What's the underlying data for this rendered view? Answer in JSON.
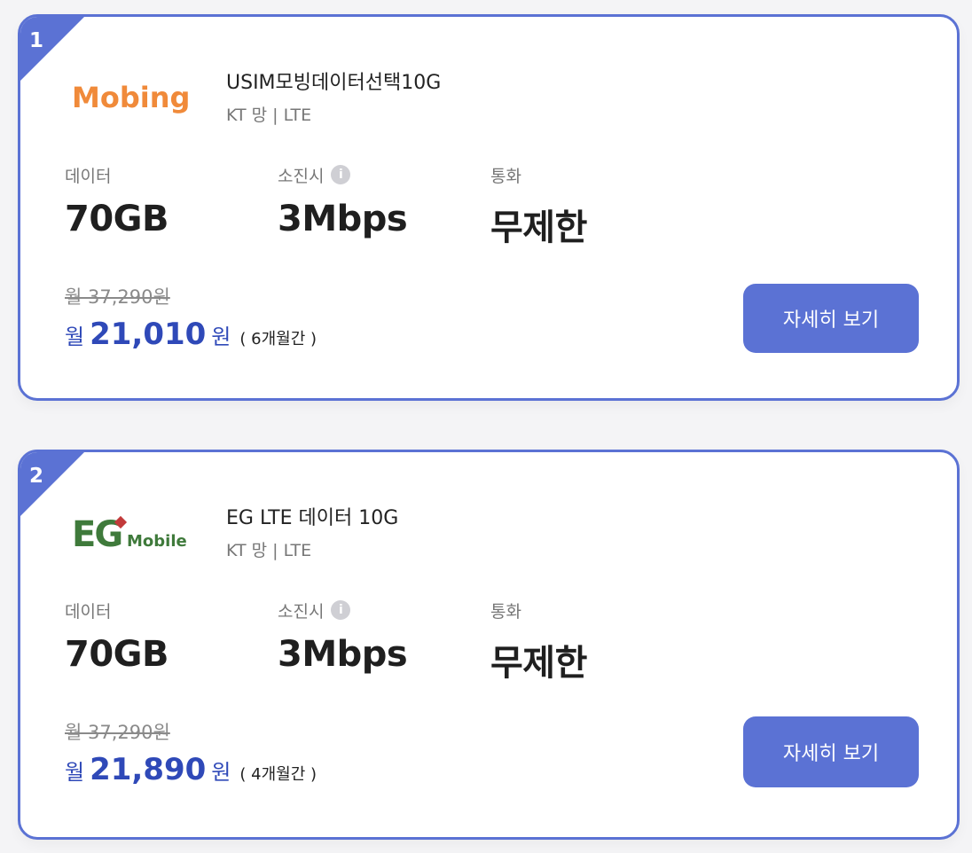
{
  "cards": [
    {
      "rank": "1",
      "logo_text": "Mobing",
      "plan_name": "USIM모빙데이터선택10G",
      "network": "KT 망 | LTE",
      "specs": {
        "data_label": "데이터",
        "data_value": "70GB",
        "exhaust_label": "소진시",
        "exhaust_value": "3Mbps",
        "call_label": "통화",
        "call_value": "무제한"
      },
      "original_price": "월 37,290원",
      "sale_prefix": "월",
      "sale_amount": "21,010",
      "sale_suffix": "원",
      "sale_period": "( 6개월간 )",
      "button_label": "자세히 보기"
    },
    {
      "rank": "2",
      "logo_text": "Mobile",
      "plan_name": "EG LTE 데이터 10G",
      "network": "KT 망 | LTE",
      "specs": {
        "data_label": "데이터",
        "data_value": "70GB",
        "exhaust_label": "소진시",
        "exhaust_value": "3Mbps",
        "call_label": "통화",
        "call_value": "무제한"
      },
      "original_price": "월 37,290원",
      "sale_prefix": "월",
      "sale_amount": "21,890",
      "sale_suffix": "원",
      "sale_period": "( 4개월간 )",
      "button_label": "자세히 보기"
    }
  ],
  "colors": {
    "accent": "#5b72d4",
    "price_blue": "#2f49b8",
    "mobing_orange": "#f08a3a",
    "eg_green": "#3f7a3b",
    "eg_red": "#c23a3a"
  },
  "icons": {
    "info": "info-icon"
  }
}
